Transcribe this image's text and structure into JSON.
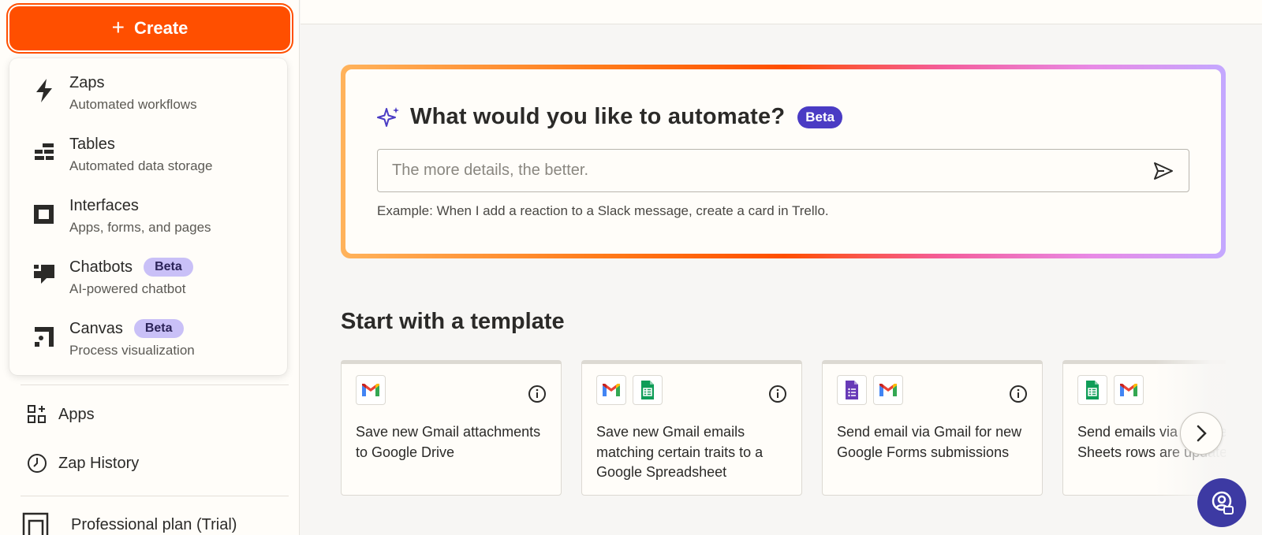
{
  "sidebar": {
    "create_label": "Create",
    "menu": [
      {
        "title": "Zaps",
        "subtitle": "Automated workflows",
        "icon": "zap-icon"
      },
      {
        "title": "Tables",
        "subtitle": "Automated data storage",
        "icon": "tables-icon"
      },
      {
        "title": "Interfaces",
        "subtitle": "Apps, forms, and pages",
        "icon": "interfaces-icon"
      },
      {
        "title": "Chatbots",
        "subtitle": "AI-powered chatbot",
        "icon": "chatbot-icon",
        "badge": "Beta"
      },
      {
        "title": "Canvas",
        "subtitle": "Process visualization",
        "icon": "canvas-icon",
        "badge": "Beta"
      }
    ],
    "links": {
      "apps": "Apps",
      "zap_history": "Zap History"
    },
    "plan_label": "Professional plan (Trial)"
  },
  "ai_prompt": {
    "title": "What would you like to automate?",
    "badge": "Beta",
    "placeholder": "The more details, the better.",
    "example": "Example: When I add a reaction to a Slack message, create a card in Trello."
  },
  "templates": {
    "title": "Start with a template",
    "cards": [
      {
        "text": "Save new Gmail attachments to Google Drive",
        "apps": [
          "gmail"
        ]
      },
      {
        "text": "Save new Gmail emails matching certain traits to a Google Spreadsheet",
        "apps": [
          "gmail",
          "google-sheets"
        ]
      },
      {
        "text": "Send email via Gmail for new Google Forms submissions",
        "apps": [
          "google-forms",
          "gmail"
        ]
      },
      {
        "text": "Send emails via Google Sheets rows are updated",
        "apps": [
          "google-sheets",
          "gmail"
        ]
      }
    ]
  },
  "colors": {
    "brand": "#ff4f00",
    "beta_pill": "#c9c0f7",
    "ai_badge": "#4a3bc4",
    "help_button": "#3d3aa3"
  }
}
